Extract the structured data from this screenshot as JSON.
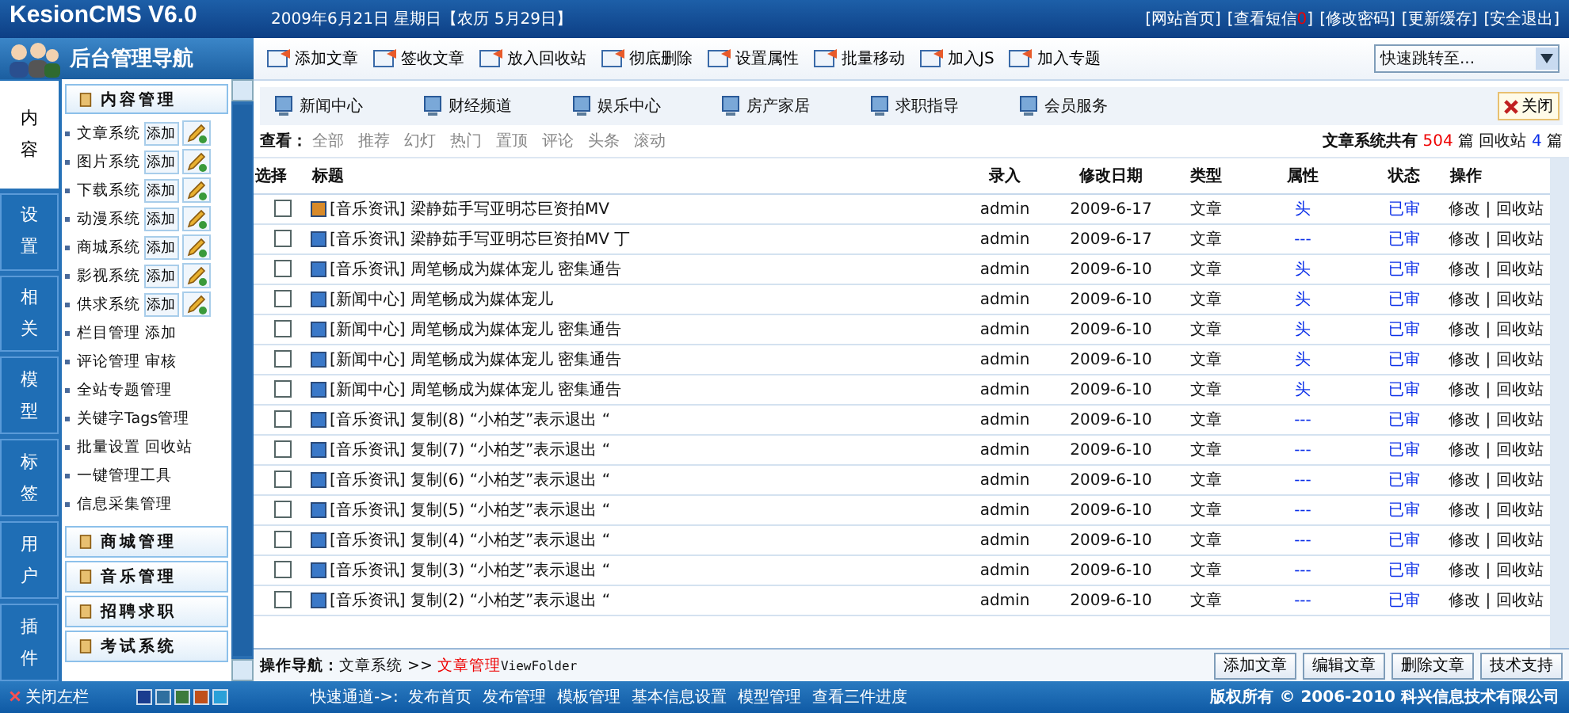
{
  "header": {
    "logo": "KesionCMS V6.0",
    "date": "2009年6月21日 星期日【农历 5月29日】",
    "links": [
      {
        "label": "[网站首页]"
      },
      {
        "label": "[查看短信",
        "count": "0",
        "end": "]"
      },
      {
        "label": "[修改密码]"
      },
      {
        "label": "[更新缓存]"
      },
      {
        "label": "[安全退出]"
      }
    ]
  },
  "sidebar": {
    "title": "后台管理导航",
    "tabs": [
      {
        "label": "内容",
        "selected": true
      },
      {
        "label": "设置",
        "selected": false
      },
      {
        "label": "相关",
        "selected": false
      },
      {
        "label": "模型",
        "selected": false
      },
      {
        "label": "标签",
        "selected": false
      },
      {
        "label": "用户",
        "selected": false
      },
      {
        "label": "插件",
        "selected": false
      }
    ],
    "section": "内容管理",
    "items": [
      {
        "kind": "system",
        "label": "文章系统",
        "button": "添加"
      },
      {
        "kind": "system",
        "label": "图片系统",
        "button": "添加"
      },
      {
        "kind": "system",
        "label": "下载系统",
        "button": "添加"
      },
      {
        "kind": "system",
        "label": "动漫系统",
        "button": "添加"
      },
      {
        "kind": "system",
        "label": "商城系统",
        "button": "添加"
      },
      {
        "kind": "system",
        "label": "影视系统",
        "button": "添加"
      },
      {
        "kind": "system",
        "label": "供求系统",
        "button": "添加"
      },
      {
        "kind": "link",
        "label": "栏目管理 添加"
      },
      {
        "kind": "link",
        "label": "评论管理 审核"
      },
      {
        "kind": "link",
        "label": "全站专题管理"
      },
      {
        "kind": "link",
        "label": "关键字Tags管理"
      },
      {
        "kind": "link",
        "label": "批量设置 回收站"
      },
      {
        "kind": "link",
        "label": "一键管理工具"
      },
      {
        "kind": "link",
        "label": "信息采集管理"
      }
    ],
    "sections": [
      "商城管理",
      "音乐管理",
      "招聘求职",
      "考试系统"
    ]
  },
  "toolbar": {
    "buttons": [
      "添加文章",
      "签收文章",
      "放入回收站",
      "彻底删除",
      "设置属性",
      "批量移动",
      "加入JS",
      "加入专题"
    ],
    "jump": "快速跳转至..."
  },
  "channels": {
    "items": [
      "新闻中心",
      "财经频道",
      "娱乐中心",
      "房产家居",
      "求职指导",
      "会员服务"
    ],
    "close": "关闭"
  },
  "filter": {
    "label": "查看：",
    "options": [
      "全部",
      "推荐",
      "幻灯",
      "热门",
      "置顶",
      "评论",
      "头条",
      "滚动"
    ],
    "summary_prefix": "文章系统共有",
    "total": "504",
    "summary_mid": "篇 回收站",
    "recycled": "4",
    "summary_suffix": "篇"
  },
  "table": {
    "columns": [
      "选择",
      "标题",
      "录入",
      "修改日期",
      "类型",
      "属性",
      "状态",
      "操作"
    ],
    "rows": [
      {
        "checked": false,
        "kind": "highlighted",
        "title": "[音乐资讯] 梁静茹手写亚明芯巨资拍MV",
        "author": "admin",
        "date": "2009-6-17",
        "type": "文章",
        "attr": "头",
        "status": "已审",
        "edit": "修改",
        "sep": "|",
        "recycle": "回收站"
      },
      {
        "checked": false,
        "kind": "normal",
        "title": "[音乐资讯] 梁静茹手写亚明芯巨资拍MV 丁",
        "author": "admin",
        "date": "2009-6-17",
        "type": "文章",
        "attr": "---",
        "status": "已审",
        "edit": "修改",
        "sep": "|",
        "recycle": "回收站"
      },
      {
        "checked": false,
        "kind": "normal",
        "title": "[音乐资讯] 周笔畅成为媒体宠儿 密集通告",
        "author": "admin",
        "date": "2009-6-10",
        "type": "文章",
        "attr": "头",
        "status": "已审",
        "edit": "修改",
        "sep": "|",
        "recycle": "回收站"
      },
      {
        "checked": false,
        "kind": "normal",
        "title": "[新闻中心] 周笔畅成为媒体宠儿",
        "author": "admin",
        "date": "2009-6-10",
        "type": "文章",
        "attr": "头",
        "status": "已审",
        "edit": "修改",
        "sep": "|",
        "recycle": "回收站"
      },
      {
        "checked": false,
        "kind": "normal",
        "title": "[新闻中心] 周笔畅成为媒体宠儿 密集通告",
        "author": "admin",
        "date": "2009-6-10",
        "type": "文章",
        "attr": "头",
        "status": "已审",
        "edit": "修改",
        "sep": "|",
        "recycle": "回收站"
      },
      {
        "checked": false,
        "kind": "normal",
        "title": "[新闻中心] 周笔畅成为媒体宠儿 密集通告",
        "author": "admin",
        "date": "2009-6-10",
        "type": "文章",
        "attr": "头",
        "status": "已审",
        "edit": "修改",
        "sep": "|",
        "recycle": "回收站"
      },
      {
        "checked": false,
        "kind": "normal",
        "title": "[新闻中心] 周笔畅成为媒体宠儿 密集通告",
        "author": "admin",
        "date": "2009-6-10",
        "type": "文章",
        "attr": "头",
        "status": "已审",
        "edit": "修改",
        "sep": "|",
        "recycle": "回收站"
      },
      {
        "checked": false,
        "kind": "normal",
        "title": "[音乐资讯] 复制(8) “小柏芝”表示退出 “",
        "author": "admin",
        "date": "2009-6-10",
        "type": "文章",
        "attr": "---",
        "status": "已审",
        "edit": "修改",
        "sep": "|",
        "recycle": "回收站"
      },
      {
        "checked": false,
        "kind": "normal",
        "title": "[音乐资讯] 复制(7) “小柏芝”表示退出 “",
        "author": "admin",
        "date": "2009-6-10",
        "type": "文章",
        "attr": "---",
        "status": "已审",
        "edit": "修改",
        "sep": "|",
        "recycle": "回收站"
      },
      {
        "checked": false,
        "kind": "normal",
        "title": "[音乐资讯] 复制(6) “小柏芝”表示退出 “",
        "author": "admin",
        "date": "2009-6-10",
        "type": "文章",
        "attr": "---",
        "status": "已审",
        "edit": "修改",
        "sep": "|",
        "recycle": "回收站"
      },
      {
        "checked": false,
        "kind": "normal",
        "title": "[音乐资讯] 复制(5) “小柏芝”表示退出 “",
        "author": "admin",
        "date": "2009-6-10",
        "type": "文章",
        "attr": "---",
        "status": "已审",
        "edit": "修改",
        "sep": "|",
        "recycle": "回收站"
      },
      {
        "checked": false,
        "kind": "normal",
        "title": "[音乐资讯] 复制(4) “小柏芝”表示退出 “",
        "author": "admin",
        "date": "2009-6-10",
        "type": "文章",
        "attr": "---",
        "status": "已审",
        "edit": "修改",
        "sep": "|",
        "recycle": "回收站"
      },
      {
        "checked": false,
        "kind": "normal",
        "title": "[音乐资讯] 复制(3) “小柏芝”表示退出 “",
        "author": "admin",
        "date": "2009-6-10",
        "type": "文章",
        "attr": "---",
        "status": "已审",
        "edit": "修改",
        "sep": "|",
        "recycle": "回收站"
      },
      {
        "checked": false,
        "kind": "normal",
        "title": "[音乐资讯] 复制(2) “小柏芝”表示退出 “",
        "author": "admin",
        "date": "2009-6-10",
        "type": "文章",
        "attr": "---",
        "status": "已审",
        "edit": "修改",
        "sep": "|",
        "recycle": "回收站"
      }
    ]
  },
  "bottom_bar": {
    "label": "操作导航：",
    "path": "文章系统 >> ",
    "current": "文章管理",
    "folder": "ViewFolder",
    "buttons": [
      "添加文章",
      "编辑文章",
      "删除文章",
      "技术支持"
    ]
  },
  "footer": {
    "close_left": "关闭左栏",
    "themes": [
      {
        "color": "#1a3d8f"
      },
      {
        "color": "#2f6f9f"
      },
      {
        "color": "#3c7a3c"
      },
      {
        "color": "#c0501a"
      },
      {
        "color": "#2aa0d8"
      }
    ],
    "quick_label": "快速通道->:",
    "quick_links": [
      "发布首页",
      "发布管理",
      "模板管理",
      "基本信息设置",
      "模型管理",
      "查看三件进度"
    ],
    "copyright": "版权所有 © 2006-2010 科兴信息技术有限公司"
  }
}
